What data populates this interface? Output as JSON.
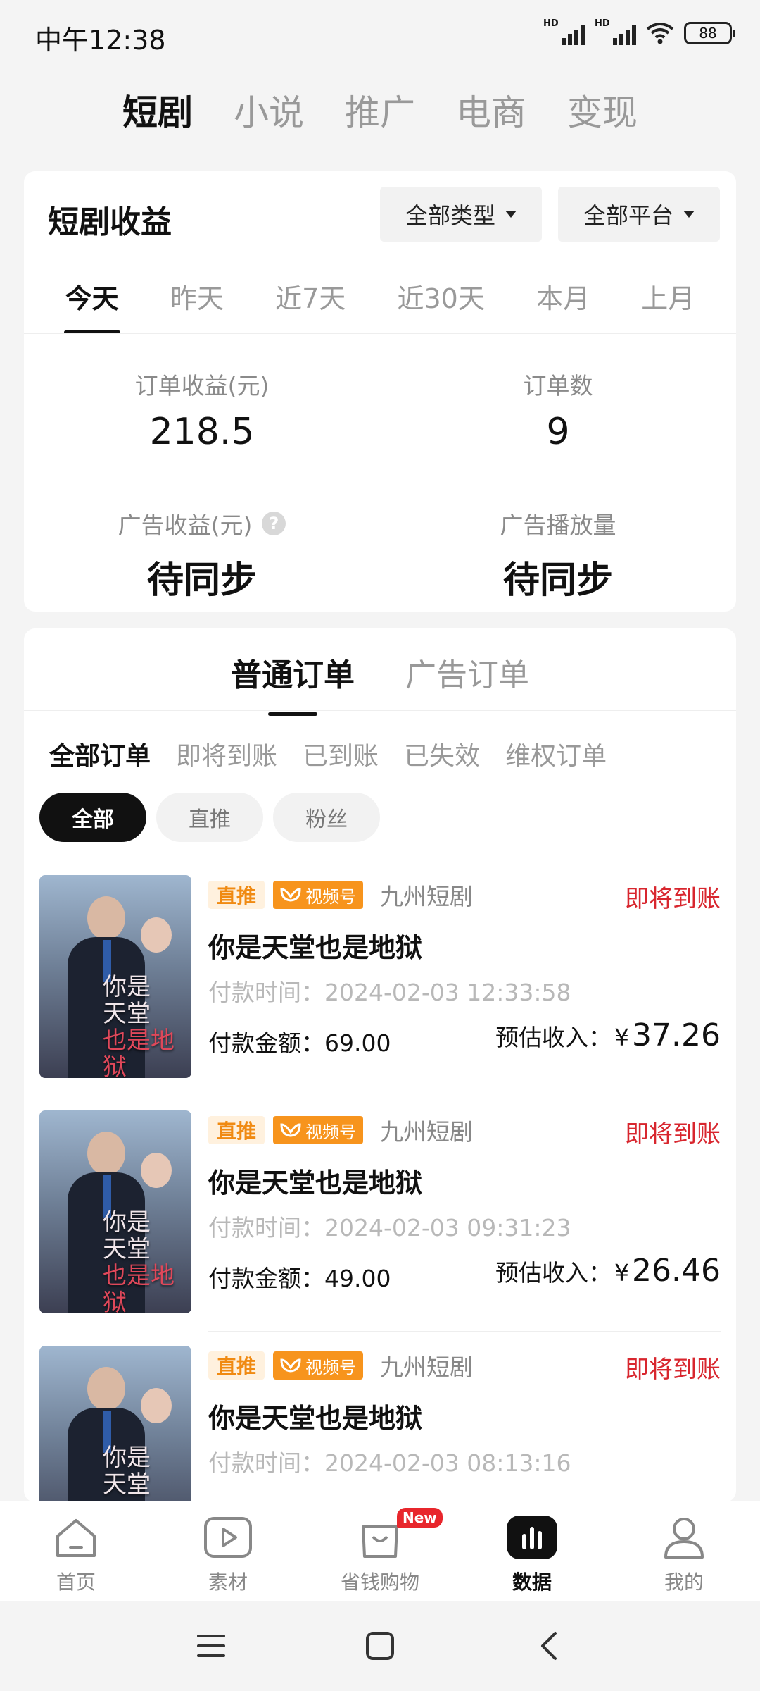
{
  "status_bar": {
    "time": "中午12:38",
    "signal_label_1": "HD",
    "signal_label_2": "HD",
    "battery": "88"
  },
  "top_tabs": [
    {
      "label": "短剧",
      "active": true
    },
    {
      "label": "小说",
      "active": false
    },
    {
      "label": "推广",
      "active": false
    },
    {
      "label": "电商",
      "active": false
    },
    {
      "label": "变现",
      "active": false
    }
  ],
  "revenue": {
    "title": "短剧收益",
    "type_filter": "全部类型",
    "platform_filter": "全部平台",
    "periods": [
      {
        "label": "今天",
        "active": true
      },
      {
        "label": "昨天",
        "active": false
      },
      {
        "label": "近7天",
        "active": false
      },
      {
        "label": "近30天",
        "active": false
      },
      {
        "label": "本月",
        "active": false
      },
      {
        "label": "上月",
        "active": false
      }
    ],
    "stats": {
      "order_income_label": "订单收益(元)",
      "order_income_value": "218.5",
      "order_count_label": "订单数",
      "order_count_value": "9",
      "ad_income_label": "广告收益(元)",
      "ad_income_value": "待同步",
      "ad_plays_label": "广告播放量",
      "ad_plays_value": "待同步",
      "help_glyph": "?"
    }
  },
  "orders": {
    "tabs": [
      {
        "label": "普通订单",
        "active": true
      },
      {
        "label": "广告订单",
        "active": false
      }
    ],
    "status_filters": [
      {
        "label": "全部订单",
        "active": true
      },
      {
        "label": "即将到账",
        "active": false
      },
      {
        "label": "已到账",
        "active": false
      },
      {
        "label": "已失效",
        "active": false
      },
      {
        "label": "维权订单",
        "active": false
      }
    ],
    "chips": [
      {
        "label": "全部",
        "active": true
      },
      {
        "label": "直推",
        "active": false
      },
      {
        "label": "粉丝",
        "active": false
      }
    ],
    "items": [
      {
        "poster_line1": "你",
        "poster_line2": "是",
        "poster_line3": "天堂",
        "poster_line4": "也是地狱",
        "tag_direct": "直推",
        "tag_channel": "视频号",
        "platform": "九州短剧",
        "status": "即将到账",
        "title": "你是天堂也是地狱",
        "pay_time": "付款时间：2024-02-03 12:33:58",
        "amount": "付款金额：69.00",
        "income_label": "预估收入：",
        "income_currency": "¥",
        "income_value": "37.26"
      },
      {
        "poster_line1": "你",
        "poster_line2": "是",
        "poster_line3": "天堂",
        "poster_line4": "也是地狱",
        "tag_direct": "直推",
        "tag_channel": "视频号",
        "platform": "九州短剧",
        "status": "即将到账",
        "title": "你是天堂也是地狱",
        "pay_time": "付款时间：2024-02-03 09:31:23",
        "amount": "付款金额：49.00",
        "income_label": "预估收入：",
        "income_currency": "¥",
        "income_value": "26.46"
      },
      {
        "poster_line1": "你",
        "poster_line2": "是",
        "poster_line3": "天堂",
        "poster_line4": "",
        "tag_direct": "直推",
        "tag_channel": "视频号",
        "platform": "九州短剧",
        "status": "即将到账",
        "title": "你是天堂也是地狱",
        "pay_time": "付款时间：2024-02-03 08:13:16",
        "amount": "",
        "income_label": "",
        "income_currency": "",
        "income_value": ""
      }
    ]
  },
  "bottom_nav": [
    {
      "label": "首页",
      "icon": "home-icon",
      "active": false
    },
    {
      "label": "素材",
      "icon": "play-icon",
      "active": false
    },
    {
      "label": "省钱购物",
      "icon": "shopping-bag-icon",
      "active": false,
      "badge": "New"
    },
    {
      "label": "数据",
      "icon": "bar-chart-icon",
      "active": true
    },
    {
      "label": "我的",
      "icon": "user-icon",
      "active": false
    }
  ],
  "colors": {
    "accent_red": "#d8262e",
    "tag_orange": "#f7941d",
    "active_dark": "#111111"
  }
}
